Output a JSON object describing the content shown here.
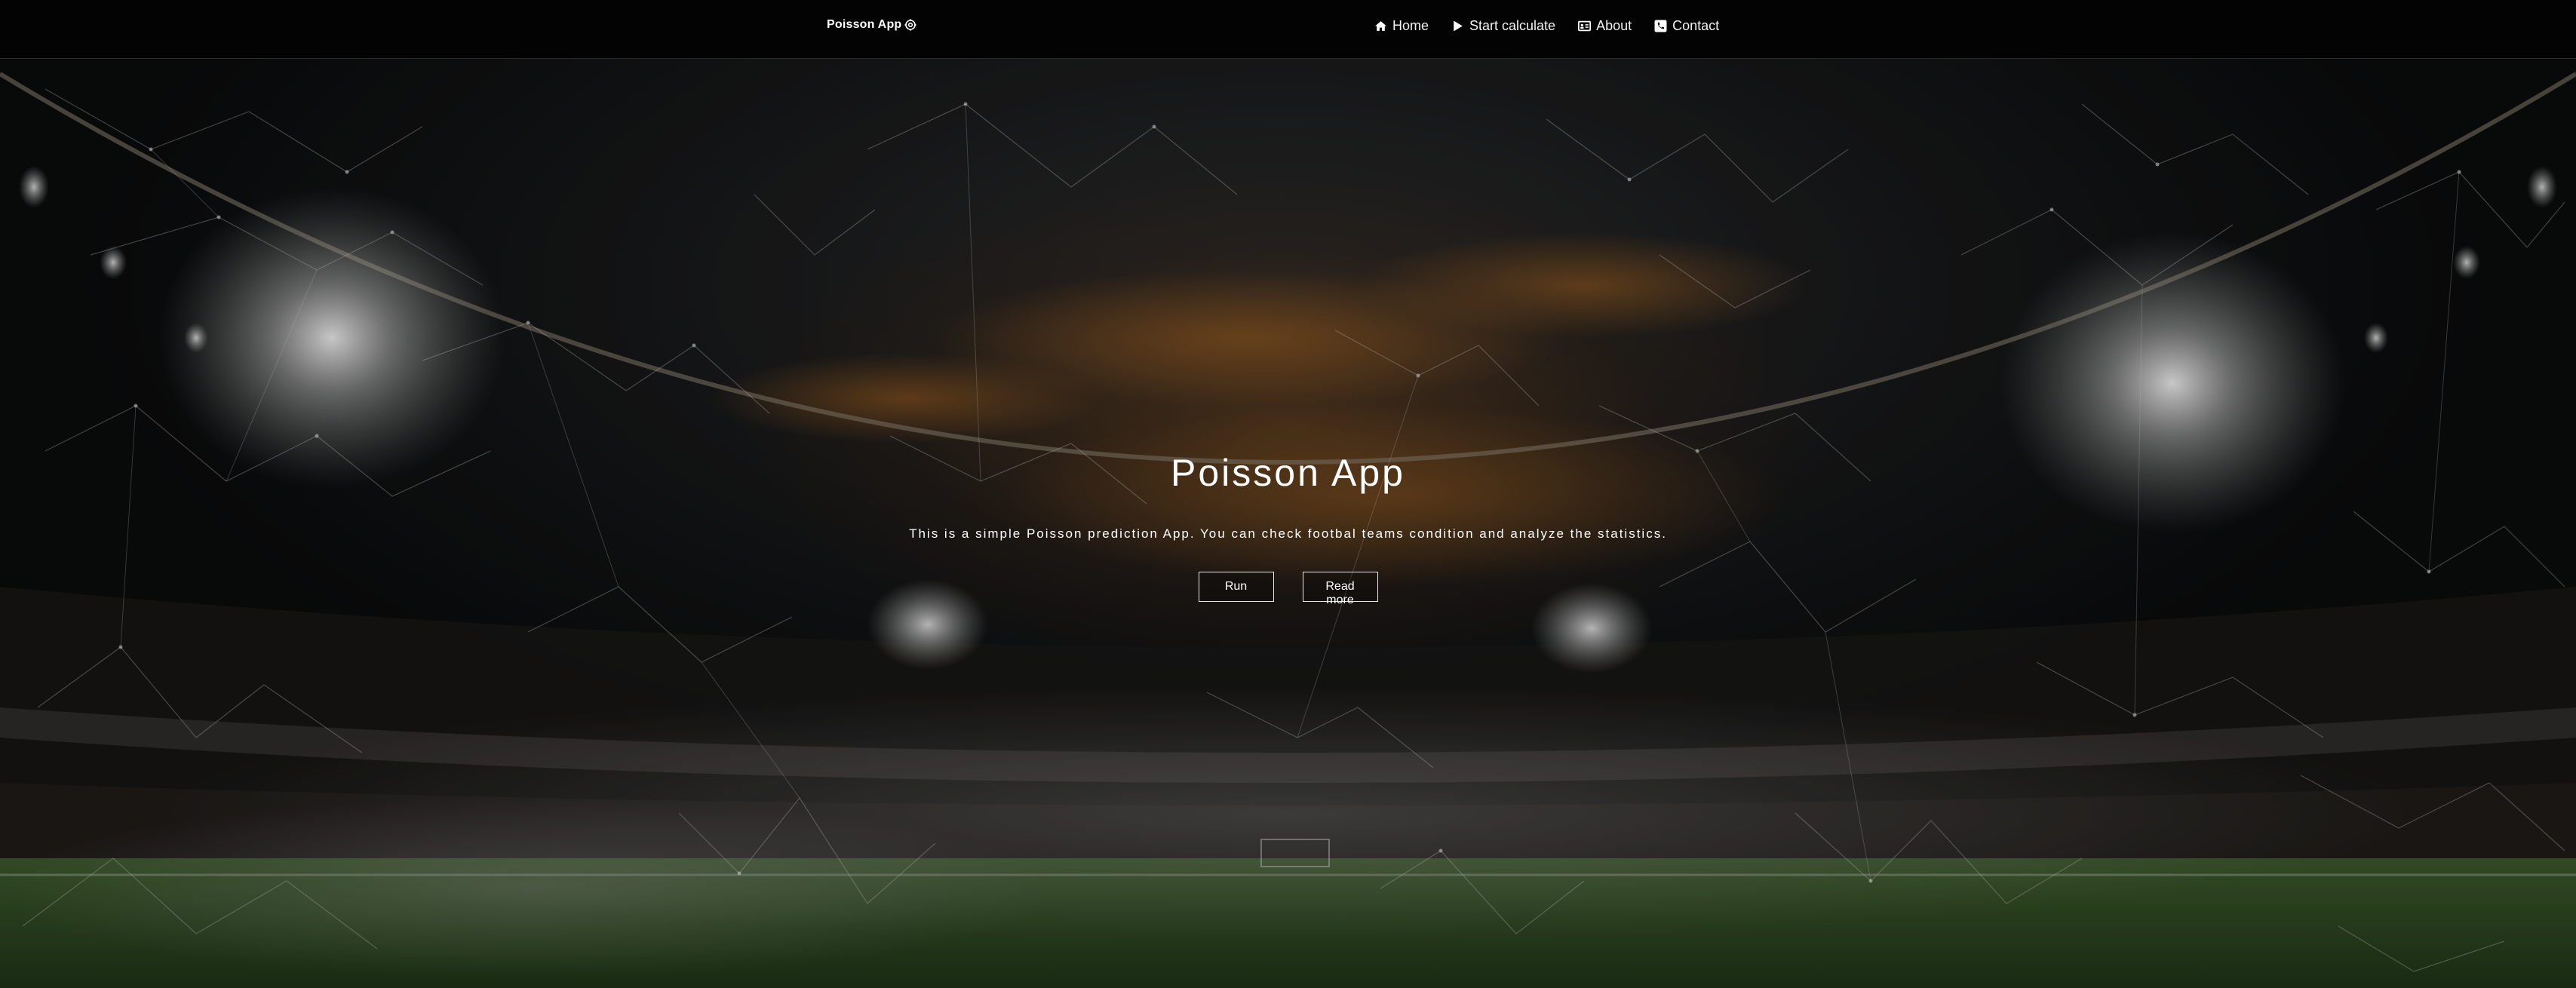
{
  "navbar": {
    "brand": "Poisson App",
    "brand_icon": "settings-gear-icon",
    "links": [
      {
        "label": "Home",
        "icon": "home-icon"
      },
      {
        "label": "Start calculate",
        "icon": "play-icon"
      },
      {
        "label": "About",
        "icon": "id-card-icon"
      },
      {
        "label": "Contact",
        "icon": "phone-square-icon"
      }
    ]
  },
  "hero": {
    "title": "Poisson App",
    "subtitle": "This is a simple Poisson prediction App. You can check footbal teams condition and analyze the statistics.",
    "run_label": "Run",
    "read_more_label": "Read more"
  },
  "colors": {
    "navbar_bg": "#030303",
    "pitch_green": "#2f4a22",
    "sky_glow": "#7a4a1c"
  }
}
